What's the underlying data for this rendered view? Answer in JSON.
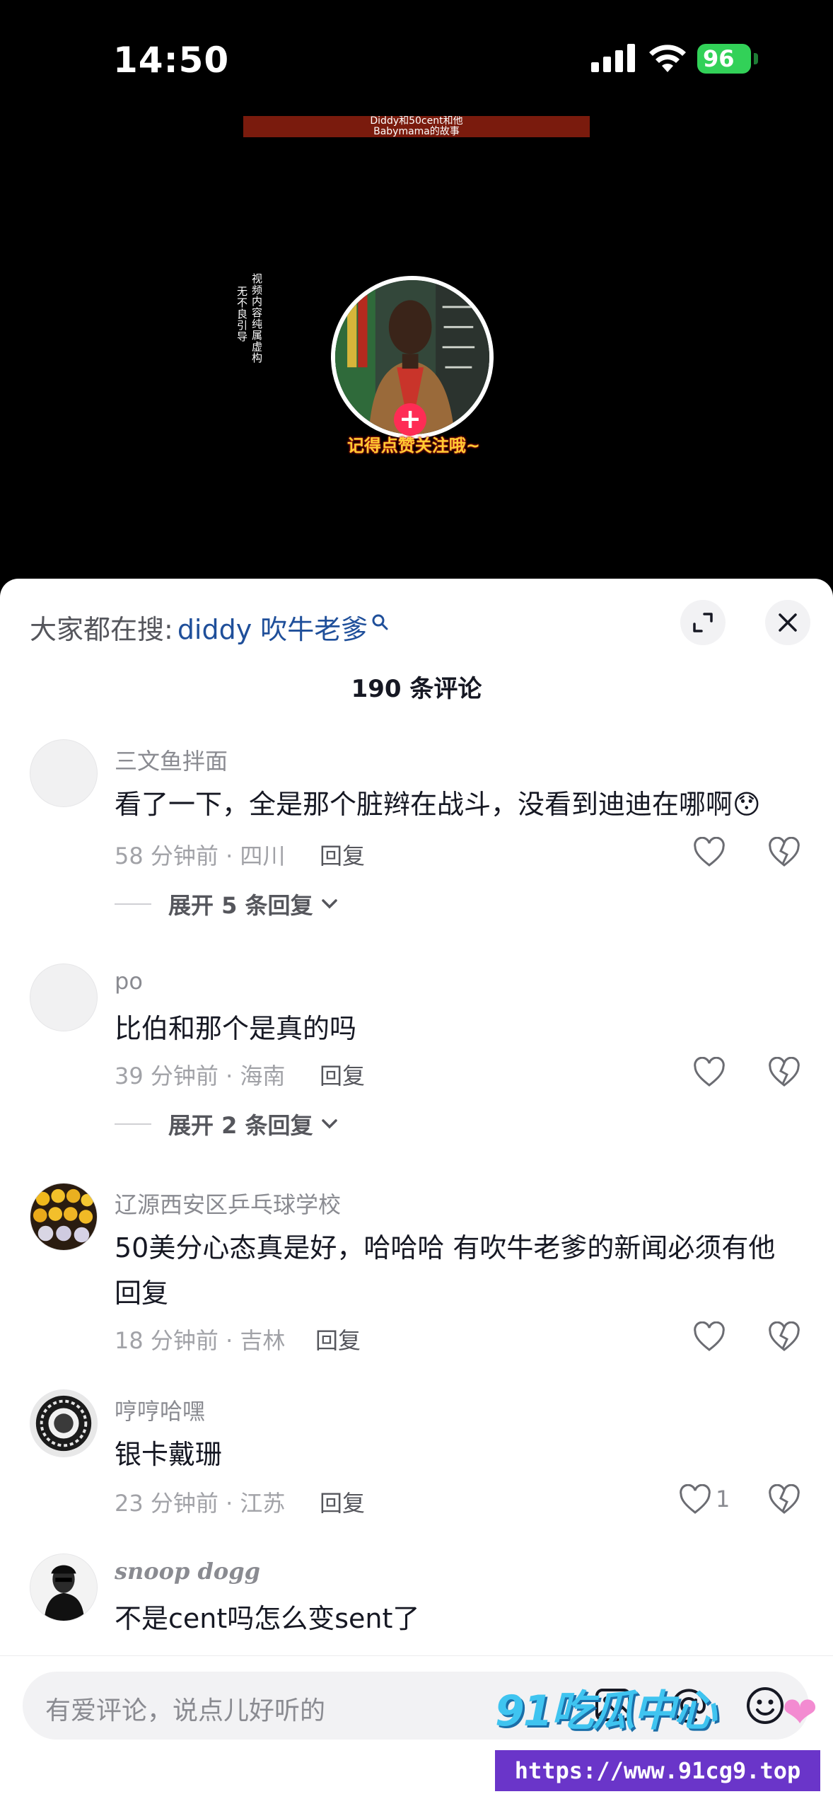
{
  "status": {
    "time": "14:50",
    "battery": "96"
  },
  "video": {
    "banner_line1": "Diddy和50cent和他",
    "banner_line2": "Babymama的故事",
    "side_text": [
      "视频内容纯属虚构",
      "无不良引导"
    ],
    "follow_caption": "记得点赞关注哦~"
  },
  "sheet": {
    "search_prefix": "大家都在搜:",
    "search_term": "diddy 吹牛老爹",
    "comment_count": "190 条评论"
  },
  "comments": [
    {
      "user": "三文鱼拌面",
      "text": "看了一下，全是那个脏辫在战斗，没看到迪迪在哪啊😯",
      "meta": "58 分钟前 · 四川",
      "reply": "回复",
      "likes": "",
      "expand": "展开 5 条回复"
    },
    {
      "user": "po",
      "text": "比伯和那个是真的吗",
      "meta": "39 分钟前 · 海南",
      "reply": "回复",
      "likes": "",
      "expand": "展开 2 条回复"
    },
    {
      "user": "辽源西安区乒乓球学校",
      "text": "50美分心态真是好，哈哈哈 有吹牛老爹的新闻必须有他回复",
      "meta": "18 分钟前 · 吉林",
      "reply": "回复",
      "likes": ""
    },
    {
      "user": "哼哼哈嘿",
      "text": "银卡戴珊",
      "meta": "23 分钟前 · 江苏",
      "reply": "回复",
      "likes": "1"
    },
    {
      "user": "snoop dogg",
      "text": "不是cent吗怎么变sent了"
    }
  ],
  "input": {
    "placeholder": "有爱评论，说点儿好听的"
  },
  "watermark": {
    "logo": "91吃瓜中心",
    "url": "https://www.91cg9.top"
  },
  "colors": {
    "accent_red": "#fe2c55",
    "link_blue": "#1f4f9a",
    "battery_green": "#32d158"
  },
  "icons": [
    "signal-icon",
    "wifi-icon",
    "search-icon",
    "expand-icon",
    "close-icon",
    "heart-icon",
    "dislike-icon",
    "chevron-down-icon",
    "image-icon",
    "at-icon",
    "emoji-icon"
  ]
}
